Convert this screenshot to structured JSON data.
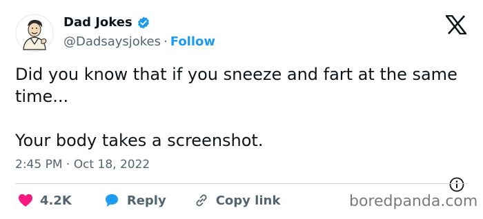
{
  "author": {
    "name": "Dad Jokes",
    "handle": "@Dadsaysjokes",
    "separator": "·",
    "follow_label": "Follow"
  },
  "tweet": {
    "line1": "Did you know that if you sneeze and fart at the same time...",
    "line2": "Your body takes a screenshot.",
    "timestamp": "2:45 PM · Oct 18, 2022"
  },
  "actions": {
    "likes": "4.2K",
    "reply_label": "Reply",
    "copy_label": "Copy link"
  },
  "watermark": "boredpanda.com",
  "icons": {
    "verified": "verified-badge-icon",
    "x_logo": "x-logo-icon",
    "info": "info-icon",
    "heart": "heart-icon",
    "reply": "reply-bubble-icon",
    "link": "link-icon"
  },
  "colors": {
    "text": "#0f1419",
    "muted": "#536471",
    "accent": "#1d9bf0",
    "like": "#f91880",
    "divider": "#cfd9de"
  }
}
